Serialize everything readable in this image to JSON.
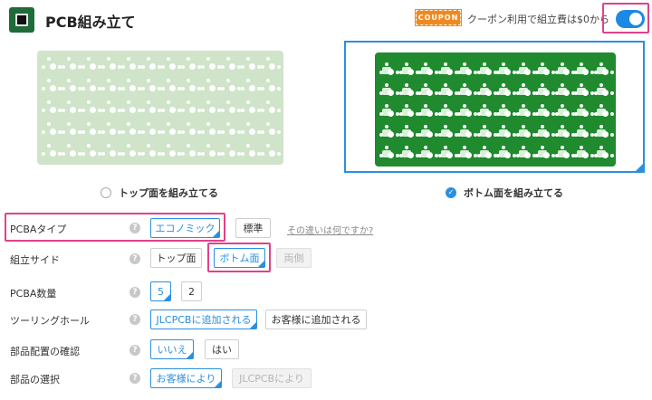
{
  "header": {
    "title": "PCB組み立て",
    "coupon_badge": "COUPON",
    "coupon_text": "クーポン利用で組立費は$0から",
    "toggle_on": true
  },
  "boards": {
    "top_label": "トップ面を組み立てる",
    "bottom_label": "ボトム面を組み立てる",
    "selected": "bottom"
  },
  "form": {
    "pcba_type": {
      "label": "PCBAタイプ",
      "options": [
        "エコノミック",
        "標準"
      ],
      "selected": "エコノミック",
      "link": "その違いは何ですか?"
    },
    "assembly_side": {
      "label": "組立サイド",
      "options": [
        "トップ面",
        "ボトム面",
        "両側"
      ],
      "selected": "ボトム面",
      "disabled": [
        "両側"
      ]
    },
    "pcba_qty": {
      "label": "PCBA数量",
      "options": [
        "5",
        "2"
      ],
      "selected": "5"
    },
    "tooling_holes": {
      "label": "ツーリングホール",
      "options": [
        "JLCPCBに追加される",
        "お客様に追加される"
      ],
      "selected": "JLCPCBに追加される"
    },
    "placement_confirm": {
      "label": "部品配置の確認",
      "options": [
        "いいえ",
        "はい"
      ],
      "selected": "いいえ"
    },
    "parts_selection": {
      "label": "部品の選択",
      "options": [
        "お客様により",
        "JLCPCBにより"
      ],
      "selected": "お客様により",
      "disabled": [
        "JLCPCBにより"
      ]
    }
  },
  "colors": {
    "accent": "#2b8fe0",
    "highlight": "#e0428a",
    "pcb_green": "#1f8a2e",
    "coupon_orange": "#f08a20"
  }
}
